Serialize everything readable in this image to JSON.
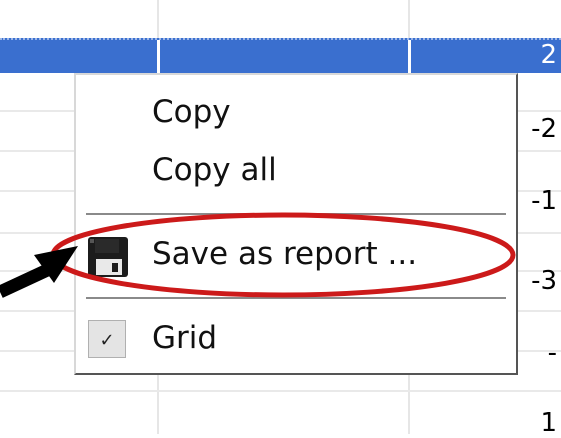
{
  "cells": {
    "selected_value": "2",
    "values": [
      "-2",
      "-1",
      "-3",
      "-",
      "1"
    ]
  },
  "context_menu": {
    "items": [
      {
        "label": "Copy",
        "icon": ""
      },
      {
        "label": "Copy all",
        "icon": ""
      },
      {
        "label": "Save as report ...",
        "icon": "floppy-disk-icon"
      },
      {
        "label": "Grid",
        "icon": "checkmark-icon",
        "checked": true
      }
    ],
    "check_mark": "✓"
  },
  "annotation": {
    "highlight_color": "#cc1a1a",
    "arrow_color": "#000000"
  },
  "colors": {
    "selection": "#3a6fcf",
    "menu_bg": "#ffffff"
  }
}
